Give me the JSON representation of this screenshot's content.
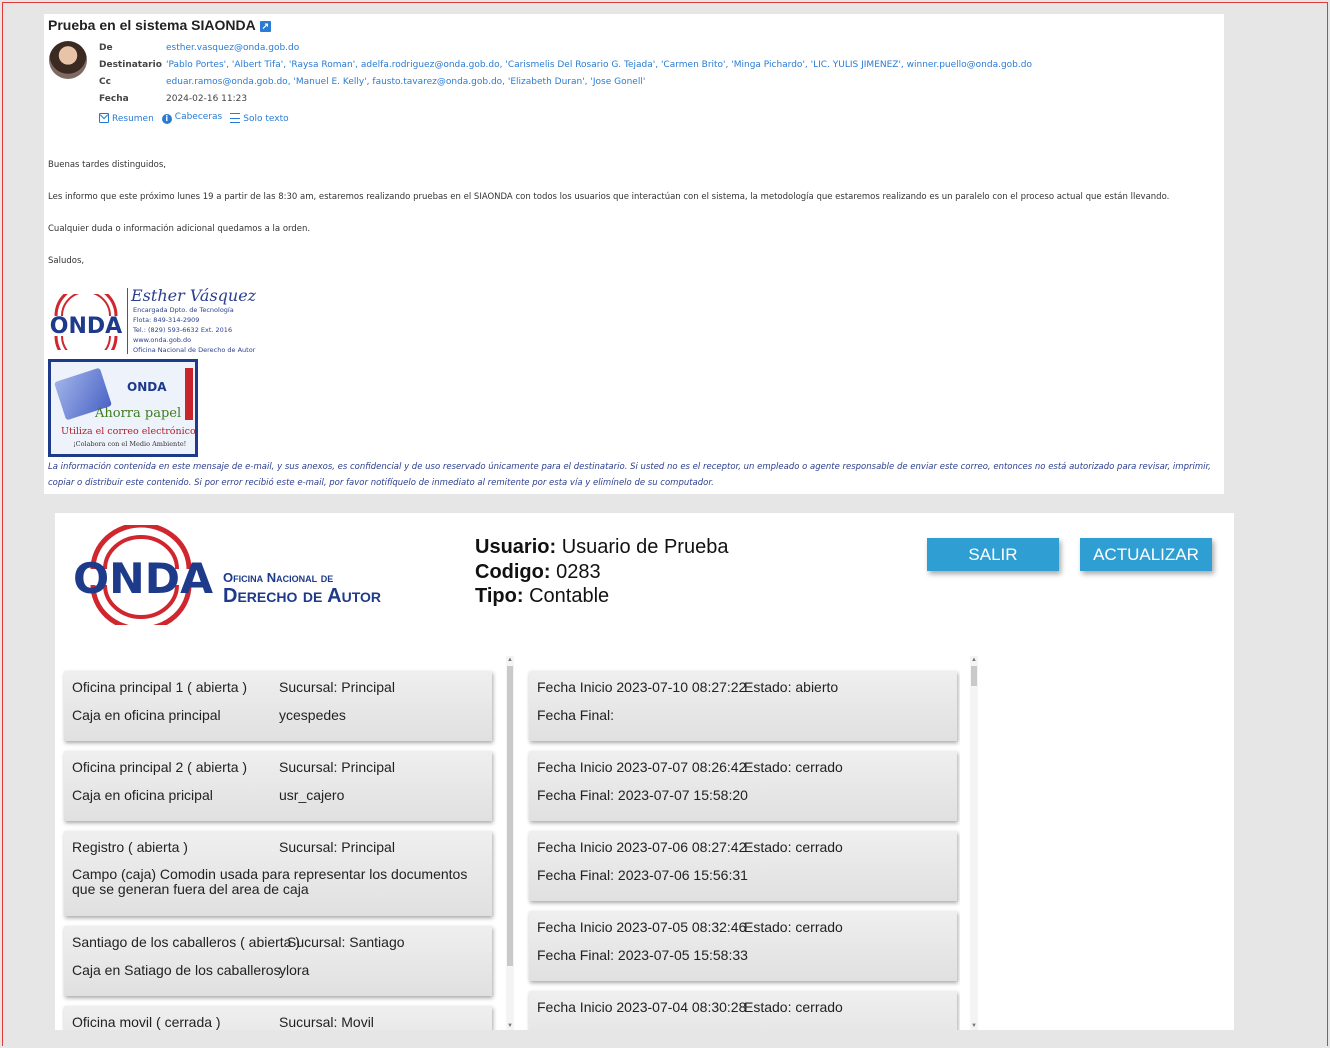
{
  "email": {
    "subject": "Prueba en el sistema SIAONDA",
    "header": {
      "de_label": "De",
      "de_value": "esther.vasquez@onda.gob.do",
      "to_label": "Destinatario",
      "to_value": "'Pablo Portes', 'Albert Tifa', 'Raysa Roman', adelfa.rodriguez@onda.gob.do, 'Carismelis Del Rosario G. Tejada', 'Carmen Brito', 'Minga Pichardo', 'LIC. YULIS JIMENEZ', winner.puello@onda.gob.do",
      "cc_label": "Cc",
      "cc_value": "eduar.ramos@onda.gob.do, 'Manuel E. Kelly', fausto.tavarez@onda.gob.do, 'Elizabeth Duran', 'Jose Gonell'",
      "date_label": "Fecha",
      "date_value": "2024-02-16 11:23",
      "links": {
        "summary": "Resumen",
        "headers": "Cabeceras",
        "text_only": "Solo texto"
      }
    },
    "body": {
      "greeting": "Buenas tardes distinguidos,",
      "p1": "Les informo que este próximo lunes 19  a partir de las 8:30 am, estaremos realizando pruebas en el SIAONDA con todos los usuarios que interactúan con el sistema, la metodología que estaremos realizando es un paralelo con el proceso actual que están llevando.",
      "p2": "Cualquier duda o información adicional quedamos a la orden.",
      "closing": "Saludos,"
    },
    "signature": {
      "logo_text": "ONDA",
      "name": "Esther Vásquez",
      "lines": [
        "Encargada Dpto. de Tecnología",
        "Flota: 849-314-2909",
        "Tel.: (829) 593-6632  Ext. 2016",
        "www.onda.gob.do",
        "Oficina Nacional de Derecho de Autor"
      ]
    },
    "eco_banner": {
      "logo_text": "ONDA",
      "title": "Ahorra papel",
      "subtitle": "Utiliza el correo electrónico",
      "small": "¡Colabora con el Medio Ambiente!"
    },
    "disclaimer": "La información contenida en este mensaje de e-mail, y sus anexos, es confidencial y de uso reservado únicamente para el destinatario. Si usted no es el receptor, un empleado o agente responsable de enviar este correo, entonces no está autorizado para revisar, imprimir, copiar o distribuir este contenido. Si por error recibió este e-mail, por favor notifíquelo de inmediato al remitente por esta vía y elimínelo de su computador."
  },
  "app": {
    "logo": {
      "brand": "ONDA",
      "line1": "Oficina Nacional de",
      "line2": "Derecho de Autor"
    },
    "user": {
      "usuario_label": "Usuario:",
      "usuario_value": "Usuario de Prueba",
      "codigo_label": "Codigo:",
      "codigo_value": "0283",
      "tipo_label": "Tipo:",
      "tipo_value": "Contable"
    },
    "buttons": {
      "salir": "SALIR",
      "actualizar": "ACTUALIZAR"
    },
    "offices": [
      {
        "name": "Oficina principal 1 ( abierta )",
        "branch": "Sucursal: Principal",
        "caja": "Caja en oficina principal",
        "user": "ycespedes"
      },
      {
        "name": "Oficina principal 2 ( abierta )",
        "branch": "Sucursal: Principal",
        "caja": "Caja en oficina pricipal",
        "user": "usr_cajero"
      },
      {
        "name": "Registro ( abierta )",
        "branch": "Sucursal: Principal",
        "caja": "Campo (caja) Comodin usada para representar los documentos que se generan fuera del area de caja",
        "user": ""
      },
      {
        "name": "Santiago de los caballeros ( abierta )",
        "branch": "Sucursal: Santiago",
        "caja": "Caja en Satiago de los caballeros",
        "user": "ylora"
      },
      {
        "name": "Oficina movil ( cerrada )",
        "branch": "Sucursal: Movil",
        "caja": "",
        "user": ""
      }
    ],
    "sessions": [
      {
        "inicio": "Fecha Inicio 2023-07-10 08:27:22",
        "estado": "Estado: abierto",
        "final": "Fecha Final:"
      },
      {
        "inicio": "Fecha Inicio 2023-07-07 08:26:42",
        "estado": "Estado: cerrado",
        "final": "Fecha Final: 2023-07-07 15:58:20"
      },
      {
        "inicio": "Fecha Inicio 2023-07-06 08:27:42",
        "estado": "Estado: cerrado",
        "final": "Fecha Final: 2023-07-06 15:56:31"
      },
      {
        "inicio": "Fecha Inicio 2023-07-05 08:32:46",
        "estado": "Estado: cerrado",
        "final": "Fecha Final: 2023-07-05 15:58:33"
      },
      {
        "inicio": "Fecha Inicio 2023-07-04 08:30:28",
        "estado": "Estado: cerrado",
        "final": ""
      }
    ]
  },
  "colors": {
    "accent_blue": "#2f9fd3",
    "onda_red": "#d0262e",
    "onda_blue": "#1e3a8a",
    "frame_red": "#e23a3a"
  }
}
